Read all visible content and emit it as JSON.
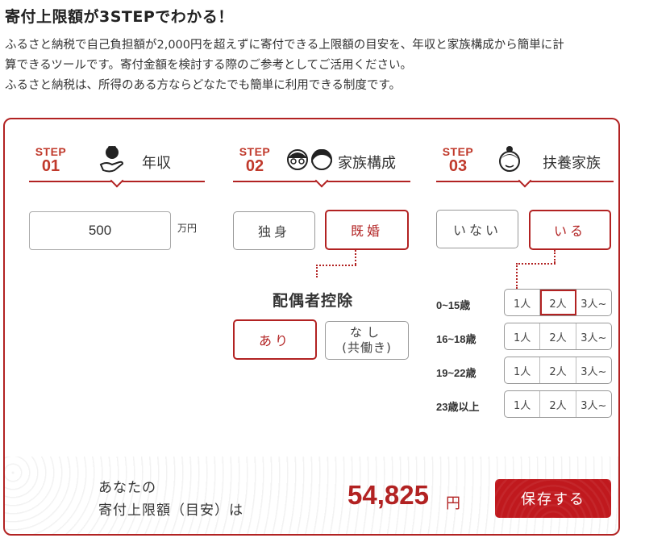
{
  "header": {
    "title": "寄付上限額が3STEPでわかる！",
    "desc_line1": "ふるさと納税で自己負担額が2,000円を超えずに寄付できる上限額の目安を、年収と家族構成から簡単に計",
    "desc_line2": "算できるツールです。寄付金額を検討する際のご参考としてご活用ください。",
    "desc_line3": "ふるさと納税は、所得のある方ならどなたでも簡単に利用できる制度です。"
  },
  "colors": {
    "accent": "#b22222",
    "save_button": "#c0191e"
  },
  "step1": {
    "tag": "STEP",
    "num": "01",
    "label": "年収",
    "icon": "wallet-hand-icon",
    "income_value": "500",
    "unit": "万円"
  },
  "step2": {
    "tag": "STEP",
    "num": "02",
    "label": "家族構成",
    "icon": "couple-icon",
    "options": [
      "独身",
      "既婚"
    ],
    "selected": "既婚",
    "spouse_title": "配偶者控除",
    "spouse_options": {
      "yes": "あり",
      "no_line1": "なし",
      "no_line2": "(共働き)"
    },
    "spouse_selected": "あり"
  },
  "step3": {
    "tag": "STEP",
    "num": "03",
    "label": "扶養家族",
    "icon": "child-icon",
    "options": [
      "いない",
      "いる"
    ],
    "selected": "いる",
    "age_groups": [
      {
        "label": "0~15歳",
        "choices": [
          "1人",
          "2人",
          "3人~"
        ],
        "selected": "2人"
      },
      {
        "label": "16~18歳",
        "choices": [
          "1人",
          "2人",
          "3人~"
        ],
        "selected": ""
      },
      {
        "label": "19~22歳",
        "choices": [
          "1人",
          "2人",
          "3人~"
        ],
        "selected": ""
      },
      {
        "label": "23歳以上",
        "choices": [
          "1人",
          "2人",
          "3人~"
        ],
        "selected": ""
      }
    ]
  },
  "result": {
    "label_line1": "あなたの",
    "label_line2": "寄付上限額（目安）は",
    "amount": "54,825",
    "yen": "円",
    "save_label": "保存する"
  }
}
